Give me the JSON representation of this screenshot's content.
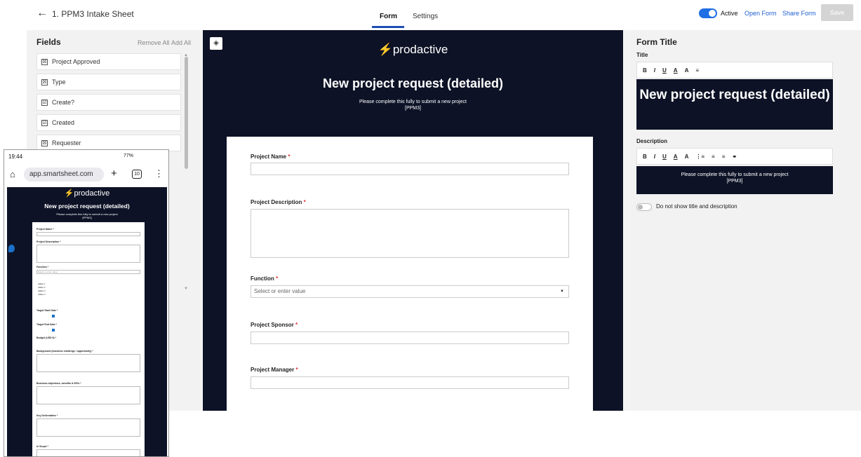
{
  "header": {
    "back_icon": "back-arrow-icon",
    "title": "1. PPM3 Intake Sheet",
    "tabs": [
      {
        "label": "Form"
      },
      {
        "label": "Settings"
      }
    ],
    "active_label": "Active",
    "open_form": "Open Form",
    "share_form": "Share Form",
    "save": "Save"
  },
  "fields_panel": {
    "title": "Fields",
    "remove_all": "Remove All",
    "add_all": "Add All",
    "items": [
      {
        "label": "Project Approved",
        "icon": "☒"
      },
      {
        "label": "Type",
        "icon": "☒"
      },
      {
        "label": "Create?",
        "icon": "☑"
      },
      {
        "label": "Created",
        "icon": "☑"
      },
      {
        "label": "Requester",
        "icon": "☒"
      }
    ]
  },
  "canvas": {
    "logo": "⚡prodactive",
    "heading": "New project request (detailed)",
    "description_line1": "Please complete this fully to submit a new project",
    "description_line2": "[PPM3]",
    "questions": [
      {
        "label": "Project Name",
        "required": "*"
      },
      {
        "label": "Project Description",
        "required": "*"
      },
      {
        "label": "Function",
        "required": "*",
        "placeholder": "Select or enter value"
      },
      {
        "label": "Project Sponsor",
        "required": "*"
      },
      {
        "label": "Project Manager",
        "required": "*"
      }
    ]
  },
  "right_panel": {
    "title": "Form Title",
    "title_label": "Title",
    "title_toolbar": [
      "B",
      "I",
      "U",
      "A",
      "A",
      "≡"
    ],
    "title_preview": "New project request (detailed)",
    "description_label": "Description",
    "description_toolbar": [
      "B",
      "I",
      "U",
      "A",
      "A",
      "⋮≡",
      "≡",
      "≡",
      "⚭"
    ],
    "description_preview_line1": "Please complete this fully to submit a new project",
    "description_preview_line2": "[PPM3]",
    "hide_toggle_label": "Do not show title and description"
  },
  "phone": {
    "time": "19:44",
    "status_right": "77%",
    "url": "app.smartsheet.com",
    "tab_count": "10",
    "logo": "⚡prodactive",
    "heading": "New project request (detailed)",
    "desc_line1": "Please complete this fully to submit a new project",
    "desc_line2": "[PPM3]",
    "labels": {
      "project_name": "Project Name *",
      "project_description": "Project Description *",
      "function": "Function *",
      "function_placeholder": "Select or enter value",
      "options": [
        "AREA 1",
        "AREA 2",
        "AREA 3",
        "AREA 4"
      ],
      "target_start": "Target Start Date *",
      "target_end": "Target End Date *",
      "budget": "Budget (USD $) *",
      "background": "Background (business challenge / opportunity) *",
      "objectives": "Business objectives, benefits & KPIs *",
      "deliverables": "Key Deliverables *",
      "in_scope": "In Scope *",
      "dots": "..."
    }
  },
  "colors": {
    "accent": "#1f4fb5",
    "canvas_bg": "#0d1226",
    "required": "#dd3333",
    "link": "#1f5fd0"
  }
}
